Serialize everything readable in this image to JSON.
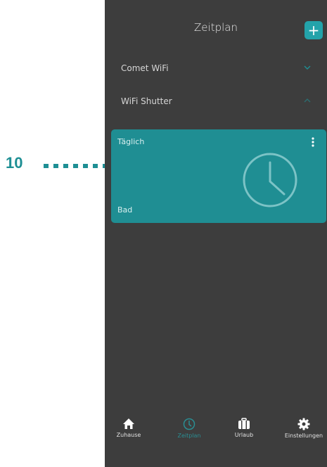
{
  "callout": {
    "number": "10"
  },
  "header": {
    "title": "Zeitplan",
    "add_label": "+"
  },
  "devices": [
    {
      "label": "Comet WiFi",
      "expanded": false
    },
    {
      "label": "WiFi Shutter",
      "expanded": true
    }
  ],
  "schedule_card": {
    "frequency": "Täglich",
    "room": "Bad",
    "icon": "clock-icon",
    "color": "#1f8e93"
  },
  "nav": {
    "items": [
      {
        "label": "Zuhause",
        "icon": "home-icon"
      },
      {
        "label": "Zeitplan",
        "icon": "clock-icon",
        "active": true
      },
      {
        "label": "Urlaub",
        "icon": "suitcase-icon"
      },
      {
        "label": "Einstellungen",
        "icon": "gear-icon"
      }
    ]
  },
  "colors": {
    "accent": "#23a3aa",
    "background": "#3d3d3d",
    "callout": "#1e8f94"
  }
}
